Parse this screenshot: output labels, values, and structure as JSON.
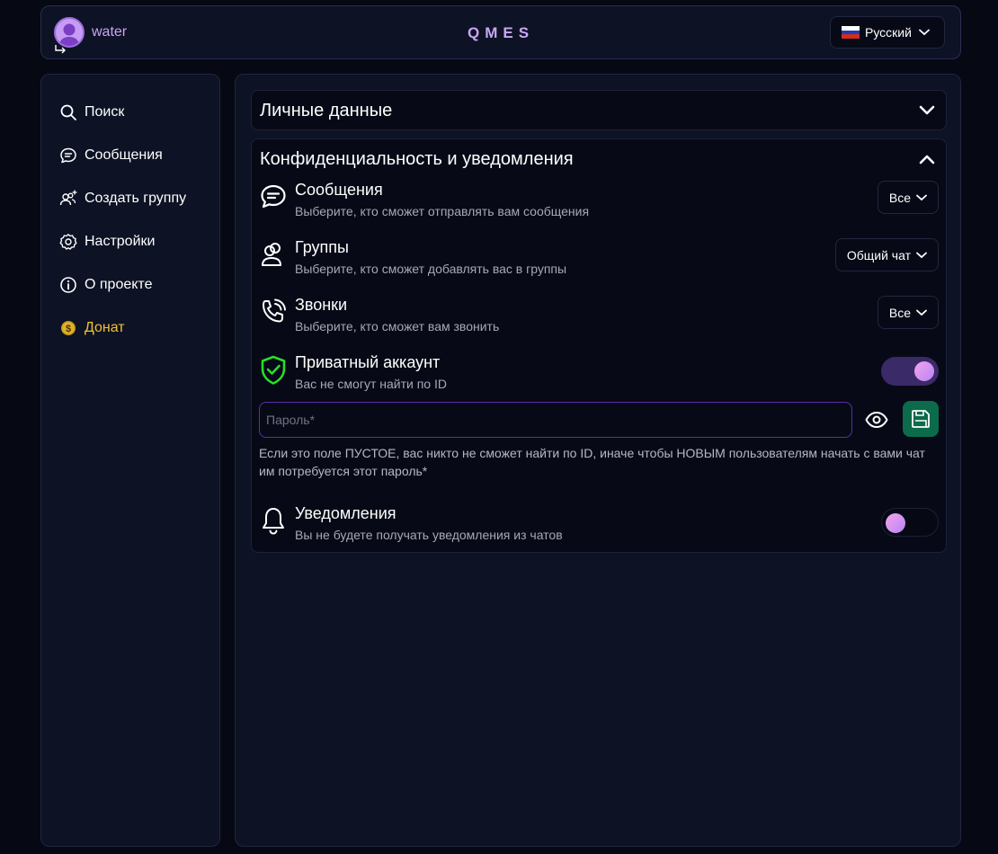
{
  "header": {
    "username": "water",
    "app_title": "QMES",
    "language": "Русский"
  },
  "sidebar": {
    "items": [
      {
        "label": "Поиск",
        "icon": "search-icon"
      },
      {
        "label": "Сообщения",
        "icon": "chat-icon"
      },
      {
        "label": "Создать группу",
        "icon": "add-group-icon"
      },
      {
        "label": "Настройки",
        "icon": "gear-icon"
      },
      {
        "label": "О проекте",
        "icon": "info-icon"
      },
      {
        "label": "Донат",
        "icon": "coin-icon",
        "color": "#f2c230"
      }
    ]
  },
  "sections": {
    "personal": {
      "title": "Личные данные",
      "expanded": false
    },
    "privacy": {
      "title": "Конфиденциальность и уведомления",
      "expanded": true,
      "messages": {
        "title": "Сообщения",
        "subtitle": "Выберите, кто сможет отправлять вам сообщения",
        "value": "Все"
      },
      "groups": {
        "title": "Группы",
        "subtitle": "Выберите, кто сможет добавлять вас в группы",
        "value": "Общий чат"
      },
      "calls": {
        "title": "Звонки",
        "subtitle": "Выберите, кто сможет вам звонить",
        "value": "Все"
      },
      "private_account": {
        "title": "Приватный аккаунт",
        "subtitle": "Вас не смогут найти по ID",
        "enabled": true
      },
      "password": {
        "placeholder": "Пароль*",
        "value": ""
      },
      "hint": "Если это поле ПУСТОЕ, вас никто не сможет найти по ID, иначе чтобы НОВЫМ пользователям начать с вами чат им потребуется этот пароль*",
      "notifications": {
        "title": "Уведомления",
        "subtitle": "Вы не будете получать уведомления из чатов",
        "enabled": false
      }
    }
  },
  "colors": {
    "accent": "#c9a6f5",
    "toggle_on": "#3b2a68",
    "shield": "#2bdc2b",
    "save": "#0b6b4a",
    "input_border": "#5a2fa8"
  }
}
